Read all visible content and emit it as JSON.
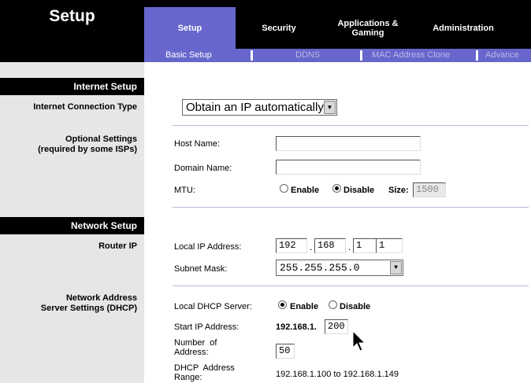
{
  "header": {
    "title": "Setup",
    "tabs": [
      {
        "label": "Setup",
        "active": true
      },
      {
        "label": "Security",
        "active": false
      },
      {
        "label": "Applications & Gaming",
        "active": false
      },
      {
        "label": "Administration",
        "active": false
      }
    ],
    "subtabs": [
      {
        "label": "Basic Setup",
        "active": true
      },
      {
        "label": "DDNS",
        "active": false
      },
      {
        "label": "MAC Address Clone",
        "active": false
      },
      {
        "label": "Advance",
        "active": false
      }
    ]
  },
  "sidebar": {
    "internet_setup": "Internet Setup",
    "connection_type": "Internet Connection Type",
    "optional_settings_1": "Optional Settings",
    "optional_settings_2": "(required by some ISPs)",
    "network_setup": "Network Setup",
    "router_ip": "Router IP",
    "dhcp_1": "Network Address",
    "dhcp_2": "Server Settings (DHCP)"
  },
  "internet": {
    "connection_type_value": "Obtain an IP automatically",
    "host_name_label": "Host Name:",
    "host_name_value": "",
    "domain_name_label": "Domain Name:",
    "domain_name_value": "",
    "mtu_label": "MTU:",
    "mtu_enable": "Enable",
    "mtu_disable": "Disable",
    "mtu_selected": "Disable",
    "mtu_size_label": "Size:",
    "mtu_size_value": "1500"
  },
  "router": {
    "local_ip_label": "Local IP Address:",
    "ip": [
      "192",
      "168",
      "1",
      "1"
    ],
    "subnet_label": "Subnet Mask:",
    "subnet_value": "255.255.255.0"
  },
  "dhcp": {
    "server_label": "Local DHCP Server:",
    "enable": "Enable",
    "disable": "Disable",
    "selected": "Enable",
    "start_label": "Start IP Address:",
    "start_prefix": "192.168.1.",
    "start_value": "200",
    "number_label_1": "Number  of",
    "number_label_2": "Address:",
    "number_value": "50",
    "range_label_1": "DHCP  Address",
    "range_label_2": "Range:",
    "range_value": "192.168.1.100 to 192.168.1.149"
  },
  "colors": {
    "accent": "#6666cc",
    "header_bg": "#000000",
    "sidebar_bg": "#e6e6e6"
  }
}
